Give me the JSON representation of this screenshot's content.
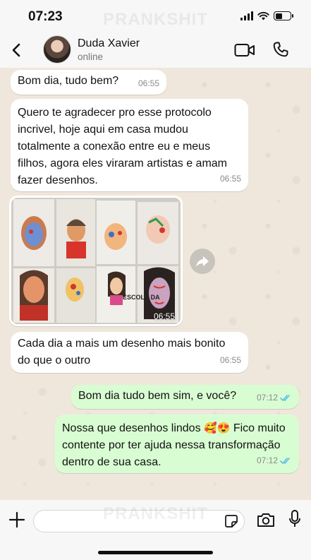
{
  "status_bar": {
    "time": "07:23"
  },
  "watermark": "PRANKSHIT",
  "header": {
    "contact_name": "Duda Xavier",
    "contact_status": "online"
  },
  "messages": [
    {
      "direction": "in",
      "text": "Bom dia, tudo bem?",
      "time": "06:55"
    },
    {
      "direction": "in",
      "text": "Quero te agradecer pro esse protocolo incrivel, hoje aqui em casa mudou totalmente a conexão entre eu e meus filhos, agora eles viraram artistas e amam fazer desenhos.",
      "time": "06:55"
    },
    {
      "direction": "in",
      "type": "image",
      "caption_on_photo": "ESCOLA DA",
      "time": "06:55"
    },
    {
      "direction": "in",
      "text": "Cada dia a mais um desenho mais bonito do que o outro",
      "time": "06:55"
    },
    {
      "direction": "out",
      "text": "Bom dia tudo bem sim, e você?",
      "time": "07:12",
      "status": "read"
    },
    {
      "direction": "out",
      "text_before": "Nossa que desenhos lindos",
      "emojis": "🥰😍",
      "text_after": "Fico muito contente por ter ajuda nessa transformação dentro de sua casa.",
      "time": "07:12",
      "status": "read"
    }
  ],
  "composer": {
    "placeholder": "",
    "value": ""
  },
  "colors": {
    "incoming_bubble": "#ffffff",
    "outgoing_bubble": "#d9fdd3",
    "read_ticks": "#53bdeb",
    "chat_background": "#efe7dc",
    "bars": "#f7f7f7"
  },
  "icons": [
    "back-arrow-icon",
    "video-camera-icon",
    "phone-icon",
    "forward-icon",
    "plus-icon",
    "sticker-icon",
    "camera-icon",
    "microphone-icon",
    "signal-icon",
    "wifi-icon",
    "battery-icon",
    "read-ticks-icon"
  ]
}
